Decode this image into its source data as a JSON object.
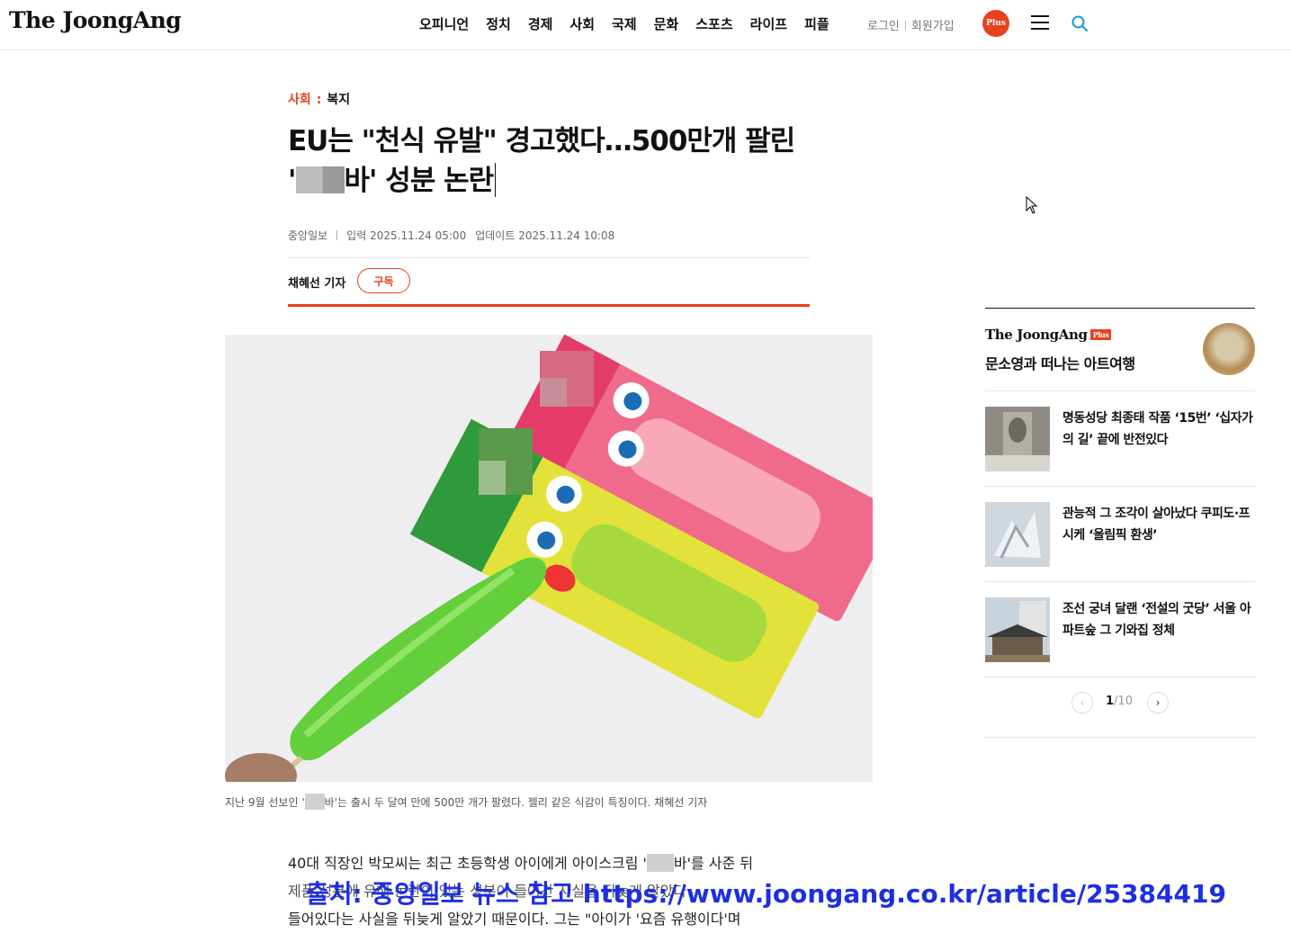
{
  "header": {
    "logo": "The JoongAng",
    "nav": [
      "오피니언",
      "정치",
      "경제",
      "사회",
      "국제",
      "문화",
      "스포츠",
      "라이프",
      "피플"
    ],
    "login": "로그인",
    "signup": "회원가입",
    "plus_badge": "Plus",
    "accent": "#e8411d"
  },
  "article": {
    "section": "사회",
    "subsection": "복지",
    "title_line1": "EU는 \"천식 유발\" 경고했다…500만개 팔린",
    "title_line2_prefix": "'",
    "title_line2_suffix": "바' 성분 논란",
    "publisher": "중앙일보",
    "input_label": "입력",
    "input_date": "2025.11.24 05:00",
    "update_label": "업데이트",
    "update_date": "2025.11.24 10:08",
    "reporter": "채혜선 기자",
    "subscribe": "구독",
    "caption_prefix": "지난 9월 선보인 '",
    "caption_suffix": "바'는 출시 두 달여 만에 500만 개가 팔렸다. 젤리 같은 식감이 특징이다. 채혜선 기자",
    "body_line1_prefix": "40대 직장인 박모씨는 최근 초등학생 아이에게 아이스크림 '",
    "body_line1_suffix": "바'를 사준 뒤",
    "body_line2": "제품 성분에 유해 논란이 있는 성분이 들어간 사실을 뒤늦게 알았다",
    "body_line3": "들어있다는 사실을 뒤늦게 알았기 때문이다. 그는 \"아이가 '요즘 유행이다'며",
    "watermark": "출처: 중앙일보 뉴스 참고 https://www.joongang.co.kr/article/25384419"
  },
  "sidebar": {
    "plus_logo": "The JoongAng",
    "plus_tag": "Plus",
    "plus_title": "문소영과 떠나는 아트여행",
    "items": [
      {
        "title": "명동성당 최종태 작품 ‘15번’ ‘십자가의 길’ 끝에 반전있다"
      },
      {
        "title": "관능적 그 조각이 살아났다 쿠피도·프시케 ‘올림픽 환생’"
      },
      {
        "title": "조선 궁녀 달랜 ‘전설의 굿당’ 서울 아파트숲 그 기와집 정체"
      }
    ],
    "page_current": "1",
    "page_total": "/10"
  }
}
